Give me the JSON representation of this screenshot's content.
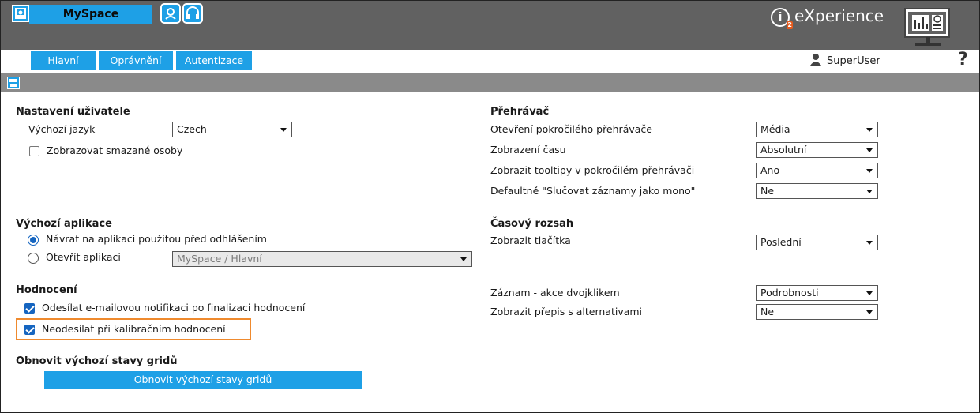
{
  "header": {
    "app_name": "MySpace",
    "brand": "eXperience",
    "brand_badge": "2",
    "help": "?",
    "user": "SuperUser",
    "accent_color": "#1ea0e6",
    "bar_color": "#616161"
  },
  "tabs": [
    {
      "label": "Hlavní",
      "active": true
    },
    {
      "label": "Oprávnění",
      "active": false
    },
    {
      "label": "Autentizace",
      "active": false
    }
  ],
  "left": {
    "user_settings": {
      "title": "Nastavení uživatele",
      "language_label": "Výchozí jazyk",
      "language_value": "Czech",
      "show_deleted_label": "Zobrazovat smazané osoby",
      "show_deleted_checked": false
    },
    "default_app": {
      "title": "Výchozí aplikace",
      "option_return": "Návrat na aplikaci použitou před odhlášením",
      "option_open": "Otevřít aplikaci",
      "open_app_value": "MySpace / Hlavní",
      "selected": "return"
    },
    "evaluation": {
      "title": "Hodnocení",
      "email_notify_label": "Odesílat e-mailovou notifikaci po finalizaci hodnocení",
      "email_notify_checked": true,
      "no_send_calib_label": "Neodesílat při kalibračním hodnocení",
      "no_send_calib_checked": true
    },
    "grid_reset": {
      "title": "Obnovit výchozí stavy gridů",
      "button": "Obnovit výchozí stavy gridů"
    }
  },
  "right": {
    "player": {
      "title": "Přehrávač",
      "rows": [
        {
          "label": "Otevření pokročilého přehrávače",
          "value": "Média"
        },
        {
          "label": "Zobrazení času",
          "value": "Absolutní"
        },
        {
          "label": "Zobrazit tooltipy v pokročilém přehrávači",
          "value": "Ano"
        },
        {
          "label": "Defaultně \"Slučovat záznamy jako mono\"",
          "value": "Ne"
        }
      ]
    },
    "time_range": {
      "title": "Časový rozsah",
      "show_buttons_label": "Zobrazit tlačítka",
      "show_buttons_value": "Poslední"
    },
    "record": {
      "dblclick_label": "Záznam - akce dvojklikem",
      "dblclick_value": "Podrobnosti",
      "transcript_label": "Zobrazit přepis s alternativami",
      "transcript_value": "Ne"
    }
  },
  "icons": [
    "app-icon",
    "myspace-icon",
    "headset-icon",
    "info-icon",
    "monitor-dashboard-icon",
    "user-icon",
    "save-icon",
    "help-icon"
  ]
}
